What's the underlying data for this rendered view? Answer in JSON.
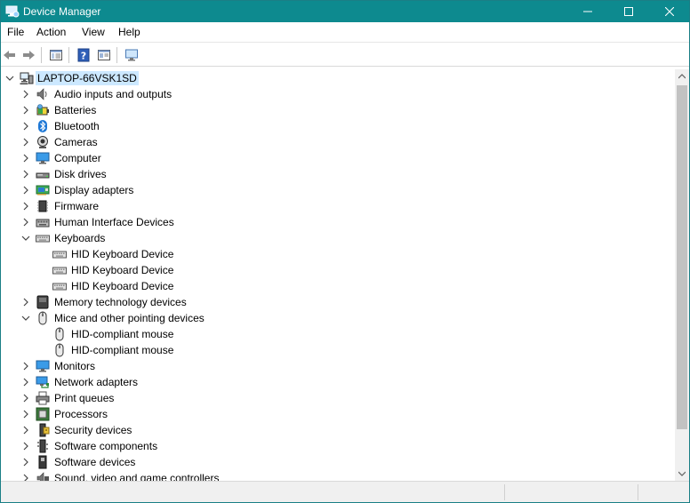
{
  "window": {
    "title": "Device Manager",
    "titlebar_color": "#0d8a8f",
    "selection_color": "#cce8ff"
  },
  "menu": {
    "items": [
      "File",
      "Action",
      "View",
      "Help"
    ]
  },
  "toolbar": {
    "buttons": [
      "back-arrow-icon",
      "forward-arrow-icon",
      "properties-icon",
      "help-icon",
      "properties-sheet-icon",
      "monitor-scan-icon"
    ]
  },
  "tree": {
    "root": "LAPTOP-66VSK1SD",
    "categories": [
      {
        "label": "Audio inputs and outputs",
        "icon": "speaker-icon",
        "expanded": false
      },
      {
        "label": "Batteries",
        "icon": "battery-icon",
        "expanded": false
      },
      {
        "label": "Bluetooth",
        "icon": "bluetooth-icon",
        "expanded": false
      },
      {
        "label": "Cameras",
        "icon": "camera-icon",
        "expanded": false
      },
      {
        "label": "Computer",
        "icon": "computer-icon",
        "expanded": false
      },
      {
        "label": "Disk drives",
        "icon": "disk-drive-icon",
        "expanded": false
      },
      {
        "label": "Display adapters",
        "icon": "display-adapter-icon",
        "expanded": false
      },
      {
        "label": "Firmware",
        "icon": "firmware-chip-icon",
        "expanded": false
      },
      {
        "label": "Human Interface Devices",
        "icon": "hid-icon",
        "expanded": false
      },
      {
        "label": "Keyboards",
        "icon": "keyboard-icon",
        "expanded": true,
        "children": [
          "HID Keyboard Device",
          "HID Keyboard Device",
          "HID Keyboard Device"
        ]
      },
      {
        "label": "Memory technology devices",
        "icon": "memory-icon",
        "expanded": false
      },
      {
        "label": "Mice and other pointing devices",
        "icon": "mouse-icon",
        "expanded": true,
        "children": [
          "HID-compliant mouse",
          "HID-compliant mouse"
        ]
      },
      {
        "label": "Monitors",
        "icon": "monitor-icon",
        "expanded": false
      },
      {
        "label": "Network adapters",
        "icon": "network-adapter-icon",
        "expanded": false
      },
      {
        "label": "Print queues",
        "icon": "printer-icon",
        "expanded": false
      },
      {
        "label": "Processors",
        "icon": "processor-icon",
        "expanded": false
      },
      {
        "label": "Security devices",
        "icon": "security-device-icon",
        "expanded": false
      },
      {
        "label": "Software components",
        "icon": "software-component-icon",
        "expanded": false
      },
      {
        "label": "Software devices",
        "icon": "software-device-icon",
        "expanded": false
      },
      {
        "label": "Sound, video and game controllers",
        "icon": "sound-controller-icon",
        "expanded": false
      }
    ]
  }
}
